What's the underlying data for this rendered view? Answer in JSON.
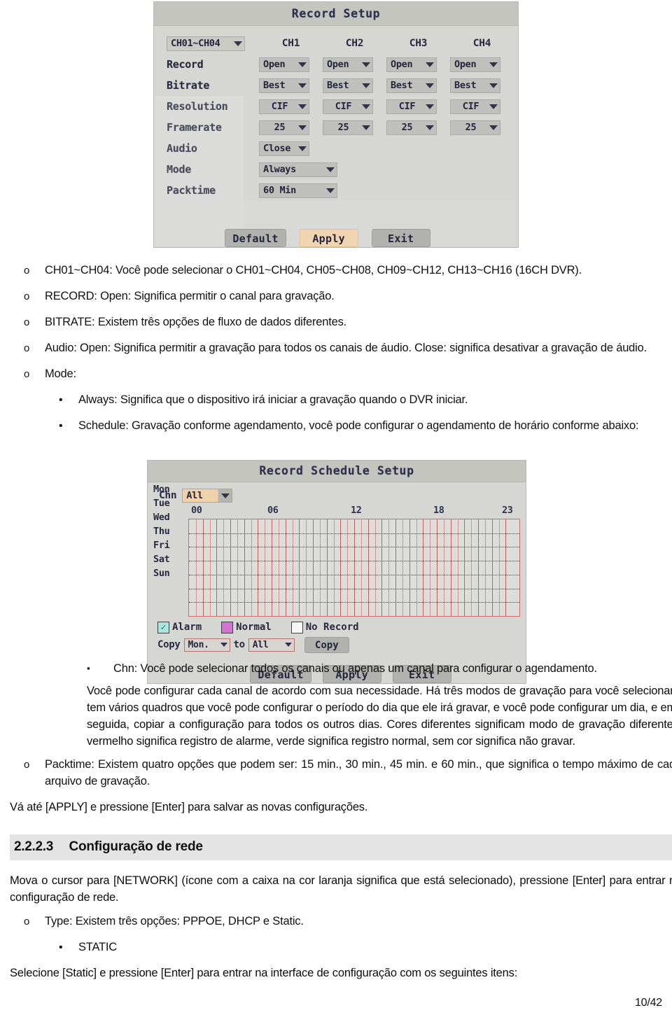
{
  "figure_record_setup": {
    "title": "Record Setup",
    "channel_selector": "CH01~CH04",
    "channel_headers": [
      "CH1",
      "CH2",
      "CH3",
      "CH4"
    ],
    "rows": [
      {
        "label": "Record",
        "values": [
          "Open",
          "Open",
          "Open",
          "Open"
        ]
      },
      {
        "label": "Bitrate",
        "values": [
          "Best",
          "Best",
          "Best",
          "Best"
        ]
      },
      {
        "label": "Resolution",
        "values": [
          "CIF",
          "CIF",
          "CIF",
          "CIF"
        ]
      },
      {
        "label": "Framerate",
        "values": [
          "25",
          "25",
          "25",
          "25"
        ]
      }
    ],
    "single_rows": [
      {
        "label": "Audio",
        "value": "Close"
      },
      {
        "label": "Mode",
        "value": "Always"
      },
      {
        "label": "Packtime",
        "value": "60 Min"
      }
    ],
    "buttons": [
      {
        "label": "Default",
        "highlighted": false
      },
      {
        "label": "Apply",
        "highlighted": true
      },
      {
        "label": "Exit",
        "highlighted": false
      }
    ],
    "highlight_color": "#fbd9b0"
  },
  "figure_schedule_setup": {
    "title": "Record Schedule Setup",
    "chn_label": "Chn",
    "chn_value": "All",
    "hour_ticks": [
      "00",
      "06",
      "12",
      "18",
      "23"
    ],
    "days": [
      "Mon",
      "Tue",
      "Wed",
      "Thu",
      "Fri",
      "Sat",
      "Sun"
    ],
    "legend": [
      {
        "label": "Alarm",
        "color": "#a8ece8",
        "checked": true
      },
      {
        "label": "Normal",
        "color": "#e06fe0",
        "checked": false
      },
      {
        "label": "No Record",
        "color": "#ffffff",
        "checked": false
      }
    ],
    "copy_label": "Copy",
    "copy_from": "Mon.",
    "copy_to_label": "to",
    "copy_to": "All",
    "copy_button": "Copy",
    "buttons": [
      {
        "label": "Default"
      },
      {
        "label": "Apply"
      },
      {
        "label": "Exit"
      }
    ]
  },
  "document": {
    "list_a": [
      "CH01~CH04: Você pode selecionar o CH01~CH04, CH05~CH08, CH09~CH12, CH13~CH16 (16CH DVR).",
      "RECORD: Open: Significa permitir o canal para gravação.",
      "BITRATE: Existem três opções de fluxo de dados diferentes.",
      "Audio: Open: Significa permitir a gravação para todos os canais de áudio. Close: significa desativar a gravação de áudio.",
      "Mode:"
    ],
    "mode_sublist": [
      "Always: Significa que o dispositivo irá iniciar a gravação quando o DVR iniciar.",
      "Schedule: Gravação conforme agendamento, você pode configurar o agendamento de horário conforme abaixo:"
    ],
    "chn_note": "Chn: Você pode selecionar todos os canais ou apenas um canal para configurar o agendamento.",
    "schedule_paragraph": "Você pode configurar cada canal de acordo com sua necessidade. Há três modos de gravação para você selecionar, tem vários quadros que você pode configurar o período do dia que ele irá gravar, e você pode configurar um dia, e em seguida, copiar a configuração para todos os outros dias. Cores diferentes significam modo de gravação diferente: vermelho significa registro de alarme, verde significa registro normal, sem cor significa não gravar.",
    "packtime_item": "Packtime: Existem quatro opções que podem ser: 15 min., 30 min., 45 min. e 60 min., que significa o tempo máximo de cada arquivo de gravação.",
    "apply_note": "Vá até [APPLY] e pressione [Enter] para salvar as novas configurações.",
    "section_number": "2.2.2.3",
    "section_title": "Configuração de rede",
    "network_intro": "Mova o cursor para [NETWORK] (ícone com a caixa na cor laranja significa que está selecionado), pressione [Enter] para entrar na configuração de rede.",
    "type_item": "Type: Existem três opções: PPPOE, DHCP e Static.",
    "static_item": "STATIC",
    "static_note": "Selecione [Static] e pressione [Enter] para entrar na interface de configuração com os seguintes itens:",
    "page_number": "10/42",
    "bullet_circle": "o",
    "bullet_disc": "•",
    "bullet_square": "▪"
  }
}
